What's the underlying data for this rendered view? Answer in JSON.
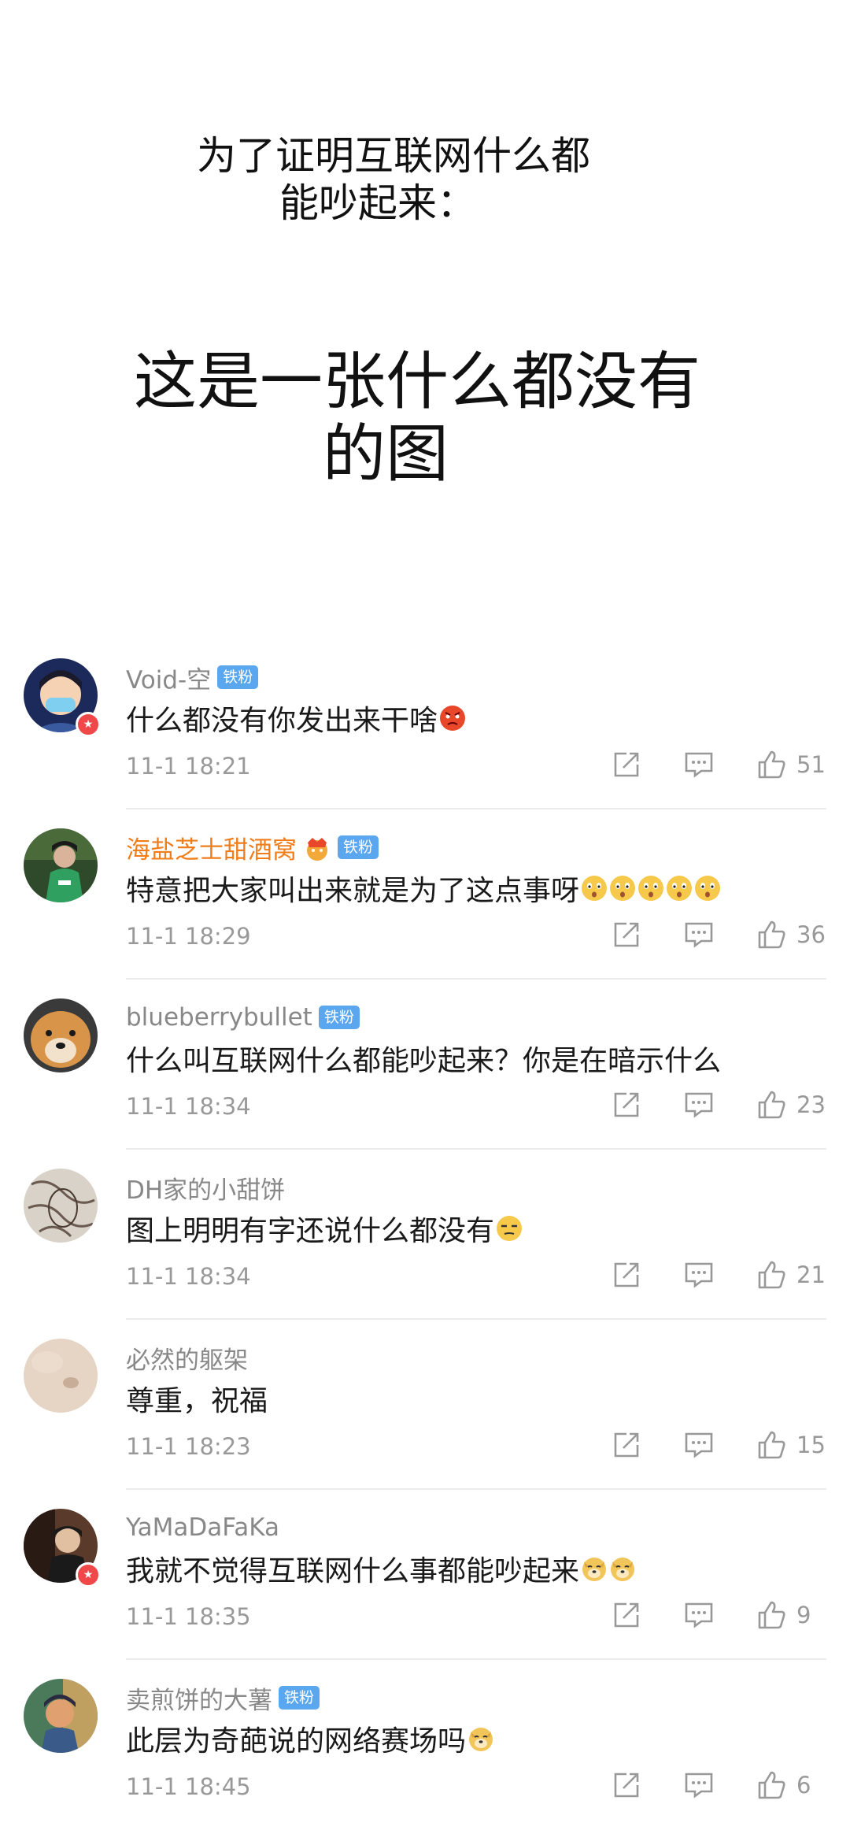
{
  "hero": {
    "line1": "为了证明互联网什么都",
    "line2": "能吵起来：",
    "line3": "这是一张什么都没有",
    "line4": "的图"
  },
  "colors": {
    "fan_badge": "#5aa7f0",
    "username_gray": "#888888",
    "username_orange": "#f07c1a",
    "meta_gray": "#999999"
  },
  "comments": [
    {
      "username": "Void-空",
      "badge": "铁粉",
      "text": "什么都没有你发出来干啥",
      "emoji": [
        "angry-emoji"
      ],
      "time": "11-1 18:21",
      "likes": "51",
      "avatar": "masked-person-avatar"
    },
    {
      "username": "海盐芝士甜酒窝",
      "badge": "铁粉",
      "text": "特意把大家叫出来就是为了这点事呀",
      "emoji": [
        "surprised-emoji",
        "surprised-emoji",
        "surprised-emoji",
        "surprised-emoji",
        "surprised-emoji"
      ],
      "time": "11-1 18:29",
      "likes": "36",
      "avatar": "person-green-avatar"
    },
    {
      "username": "blueberrybullet",
      "badge": "铁粉",
      "text": "什么叫互联网什么都能吵起来？你是在暗示什么",
      "emoji": [],
      "time": "11-1 18:34",
      "likes": "23",
      "avatar": "dog-avatar"
    },
    {
      "username": "DH家的小甜饼",
      "badge": "",
      "text": "图上明明有字还说什么都没有",
      "emoji": [
        "smirk-emoji"
      ],
      "time": "11-1 18:34",
      "likes": "21",
      "avatar": "sketch-avatar"
    },
    {
      "username": "必然的躯架",
      "badge": "",
      "text": "尊重，祝福",
      "emoji": [],
      "time": "11-1 18:23",
      "likes": "15",
      "avatar": "beige-avatar"
    },
    {
      "username": "YaMaDaFaKa",
      "badge": "",
      "text": "我就不觉得互联网什么事都能吵起来",
      "emoji": [
        "doge-emoji",
        "doge-emoji"
      ],
      "time": "11-1 18:35",
      "likes": "9",
      "avatar": "dark-person-avatar"
    },
    {
      "username": "卖煎饼的大薯",
      "badge": "铁粉",
      "text": "此层为奇葩说的网络赛场吗",
      "emoji": [
        "doge-emoji"
      ],
      "time": "11-1 18:45",
      "likes": "6",
      "avatar": "painting-avatar"
    }
  ]
}
